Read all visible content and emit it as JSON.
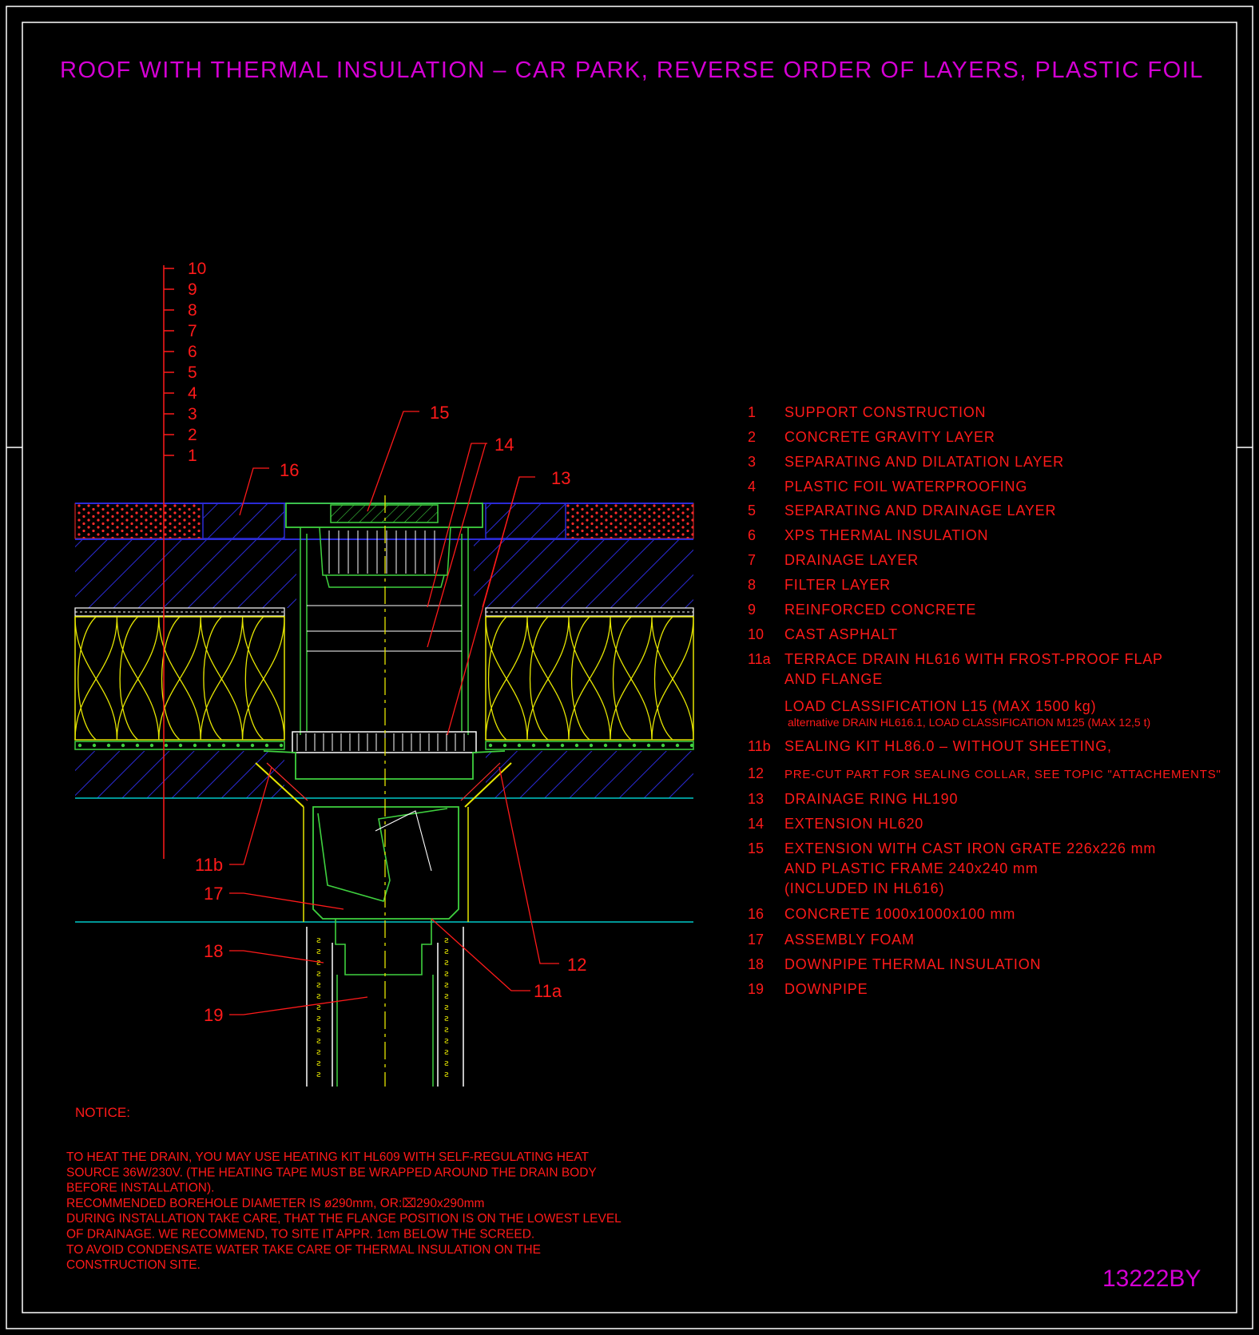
{
  "title": "ROOF WITH THERMAL INSULATION – CAR PARK, REVERSE ORDER OF LAYERS, PLASTIC FOIL",
  "drawing_code": "13222BY",
  "colors": {
    "background": "#000000",
    "border": "#ffffff",
    "title": "#d400d4",
    "text": "#ff1a1a",
    "hatch_blue": "#2b2bd6",
    "insulation": "#e6e600",
    "drain": "#3fd13f",
    "axis": "#e6e600",
    "level_line": "#00c8c8"
  },
  "layer_scale": [
    "10",
    "9",
    "8",
    "7",
    "6",
    "5",
    "4",
    "3",
    "2",
    "1"
  ],
  "callouts": {
    "c15": "15",
    "c14": "14",
    "c13": "13",
    "c16": "16",
    "c11b": "11b",
    "c17": "17",
    "c18": "18",
    "c19": "19",
    "c12": "12",
    "c11a": "11a"
  },
  "legend": [
    {
      "num": "1",
      "lines": [
        "SUPPORT CONSTRUCTION"
      ]
    },
    {
      "num": "2",
      "lines": [
        "CONCRETE GRAVITY LAYER"
      ]
    },
    {
      "num": "3",
      "lines": [
        "SEPARATING AND DILATATION LAYER"
      ]
    },
    {
      "num": "4",
      "lines": [
        "PLASTIC FOIL WATERPROOFING"
      ]
    },
    {
      "num": "5",
      "lines": [
        "SEPARATING AND DRAINAGE LAYER"
      ]
    },
    {
      "num": "6",
      "lines": [
        "XPS THERMAL INSULATION"
      ]
    },
    {
      "num": "7",
      "lines": [
        "DRAINAGE LAYER"
      ]
    },
    {
      "num": "8",
      "lines": [
        "FILTER LAYER"
      ]
    },
    {
      "num": "9",
      "lines": [
        "REINFORCED CONCRETE"
      ]
    },
    {
      "num": "10",
      "lines": [
        "CAST ASPHALT"
      ]
    },
    {
      "num": "11a",
      "lines": [
        "TERRACE DRAIN HL616 WITH FROST-PROOF FLAP",
        "AND FLANGE",
        "LOAD CLASSIFICATION L15 (MAX 1500 kg)"
      ],
      "small": "alternative DRAIN HL616.1, LOAD CLASSIFICATION M125 (MAX 12,5 t)"
    },
    {
      "num": "11b",
      "lines": [
        "SEALING KIT HL86.0 – WITHOUT SHEETING,"
      ]
    },
    {
      "num": "12",
      "lines": [
        "PRE-CUT PART FOR SEALING COLLAR, SEE TOPIC \"ATTACHEMENTS\""
      ]
    },
    {
      "num": "13",
      "lines": [
        "DRAINAGE RING HL190"
      ]
    },
    {
      "num": "14",
      "lines": [
        "EXTENSION HL620"
      ]
    },
    {
      "num": "15",
      "lines": [
        "EXTENSION WITH CAST IRON GRATE 226x226 mm",
        "AND PLASTIC FRAME 240x240 mm",
        "(INCLUDED IN HL616)"
      ]
    },
    {
      "num": "16",
      "lines": [
        "CONCRETE 1000x1000x100 mm"
      ]
    },
    {
      "num": "17",
      "lines": [
        "ASSEMBLY FOAM"
      ]
    },
    {
      "num": "18",
      "lines": [
        "DOWNPIPE THERMAL INSULATION"
      ]
    },
    {
      "num": "19",
      "lines": [
        "DOWNPIPE"
      ]
    }
  ],
  "notice": {
    "heading": "NOTICE:",
    "lines": [
      "TO HEAT THE DRAIN, YOU MAY USE HEATING KIT HL609 WITH SELF-REGULATING HEAT",
      "SOURCE 36W/230V. (THE HEATING TAPE MUST BE WRAPPED AROUND THE DRAIN BODY",
      "BEFORE INSTALLATION).",
      "RECOMMENDED BOREHOLE DIAMETER IS ø290mm, OR:⌧290x290mm",
      "DURING INSTALLATION TAKE CARE, THAT THE FLANGE POSITION IS ON THE LOWEST LEVEL",
      "OF DRAINAGE. WE RECOMMEND, TO SITE IT APPR. 1cm BELOW THE SCREED.",
      "TO AVOID CONDENSATE WATER TAKE CARE OF THERMAL INSULATION ON THE",
      "CONSTRUCTION SITE."
    ]
  }
}
